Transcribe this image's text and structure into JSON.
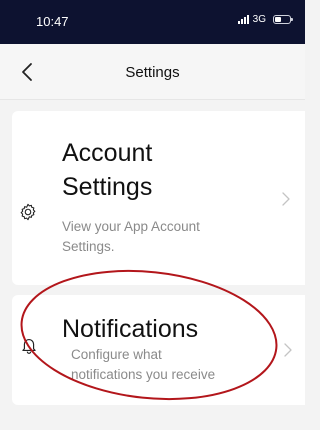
{
  "status_bar": {
    "time": "10:47",
    "network": "3G"
  },
  "header": {
    "title": "Settings",
    "back_icon": "chevron-left-icon"
  },
  "cards": [
    {
      "title_line1": "Account",
      "title_line2": "Settings",
      "description_line1": "View your App Account",
      "description_line2": "Settings.",
      "icon": "gear-icon"
    },
    {
      "title": "Notifications",
      "description_line1": "Configure what",
      "description_line2": "notifications you receive",
      "icon": "bell-icon"
    }
  ],
  "colors": {
    "status_bar_bg": "#0d1230",
    "background": "#f3f3f3",
    "card_bg": "#ffffff",
    "annotation": "#b3161b"
  }
}
